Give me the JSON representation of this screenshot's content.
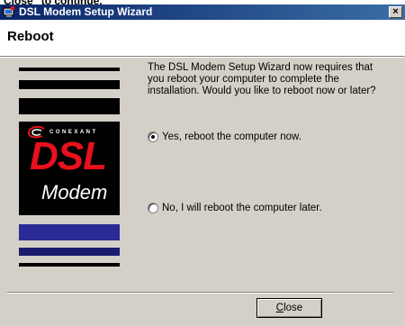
{
  "top_cut_text": "Close\" to continue.",
  "window": {
    "title": "DSL Modem Setup Wizard",
    "close_glyph": "×"
  },
  "header": {
    "title": "Reboot"
  },
  "logo": {
    "brand": "CONEXANT",
    "big": "DSL",
    "sub": "Modem"
  },
  "message": "The DSL Modem Setup Wizard now requires that you reboot your computer to complete the installation.  Would you like to reboot now or later?",
  "options": [
    {
      "label": "Yes, reboot the computer now.",
      "checked": true
    },
    {
      "label": "No, I will reboot the computer later.",
      "checked": false
    }
  ],
  "buttons": {
    "close_label": "Close",
    "close_mnemonic": "C",
    "close_rest": "lose"
  },
  "colors": {
    "titlebar": "#0a246a",
    "accent_bar": "#2a2a96",
    "dsl": "#e8101c"
  },
  "icons": [
    "setup-wizard-icon",
    "close-icon",
    "conexant-swirl-icon"
  ]
}
